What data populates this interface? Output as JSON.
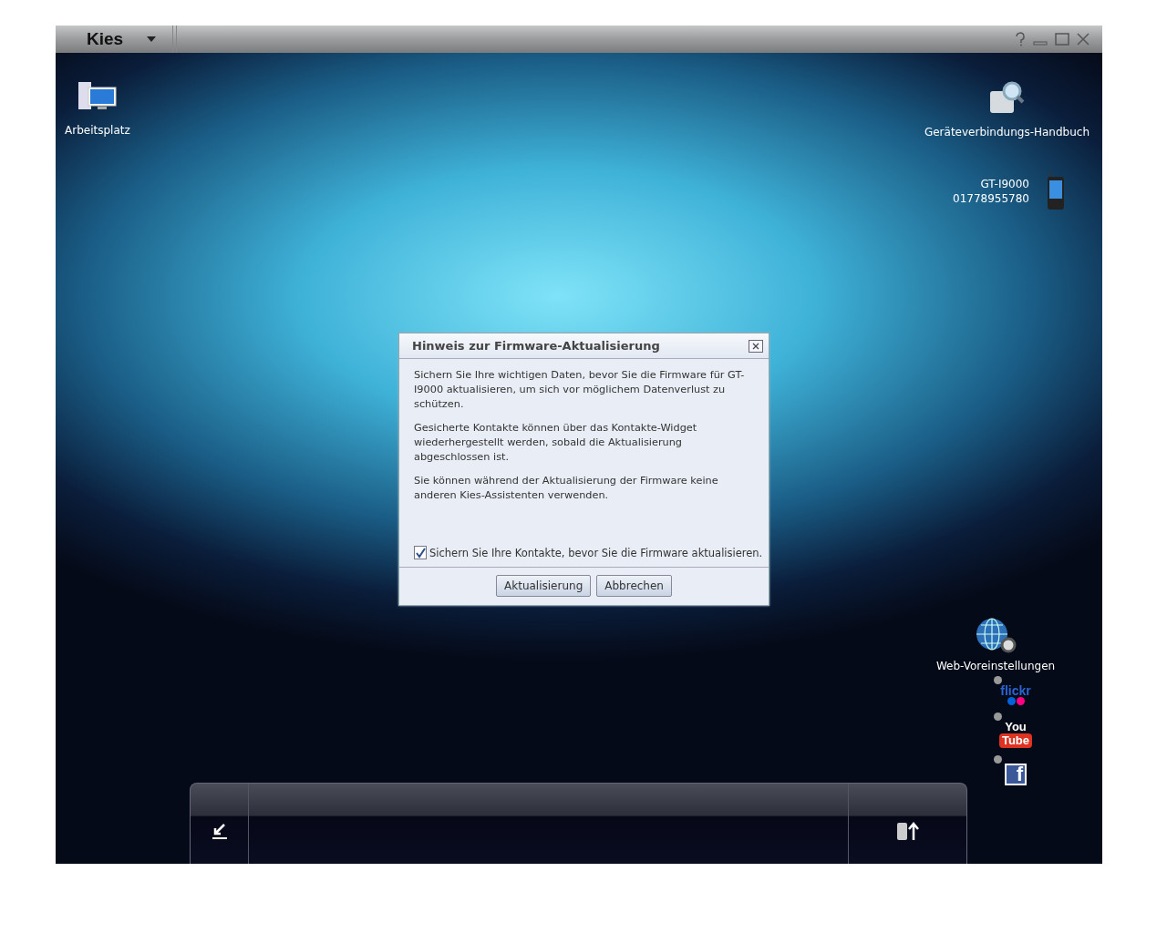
{
  "window": {
    "logo": "Kies"
  },
  "desktop_icons": [
    {
      "kind": "computer",
      "label": "Arbeitsplatz"
    },
    {
      "kind": "manual",
      "label": "Geräteverbindungs-Handbuch"
    }
  ],
  "device": {
    "model": "GT-I9000",
    "number": "01778955780"
  },
  "dialog": {
    "title": "Hinweis zur Firmware-Aktualisierung",
    "paragraphs": [
      "Sichern Sie Ihre wichtigen Daten, bevor Sie die Firmware für GT-I9000 aktualisieren, um sich vor möglichem Datenverlust zu schützen.",
      "Gesicherte Kontakte können über das Kontakte-Widget wiederhergestellt werden, sobald die Aktualisierung abgeschlossen ist.",
      "Sie können während der Aktualisierung der Firmware keine anderen Kies-Assistenten verwenden."
    ],
    "checkbox": {
      "label": "Sichern Sie Ihre Kontakte, bevor Sie die Firmware aktualisieren.",
      "checked": true
    },
    "buttons": [
      "Aktualisierung",
      "Abbrechen"
    ]
  },
  "web_settings": {
    "label": "Web-Voreinstellungen",
    "services": [
      {
        "kind": "flickr",
        "lines": [
          "flickr"
        ]
      },
      {
        "kind": "youtube",
        "lines": [
          "You",
          "Tube"
        ]
      },
      {
        "kind": "facebook",
        "lines": [
          "f"
        ]
      }
    ]
  }
}
